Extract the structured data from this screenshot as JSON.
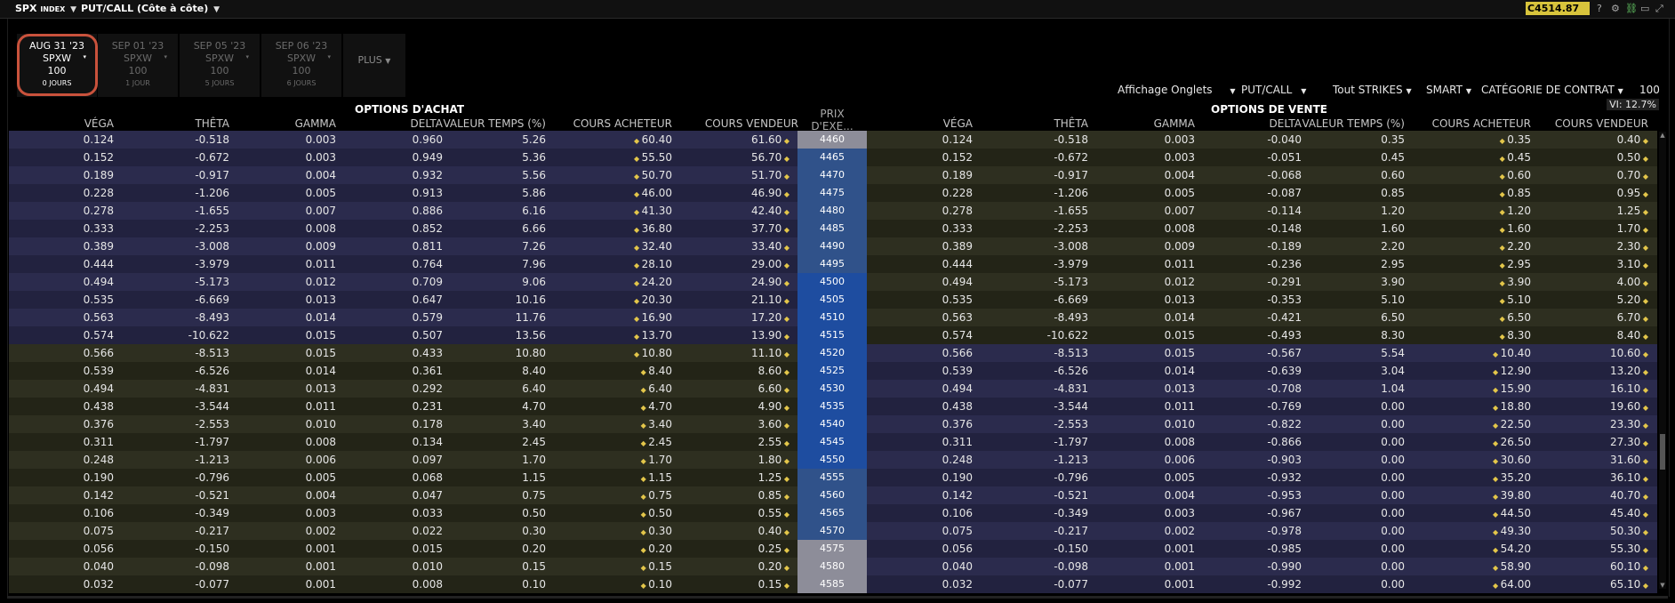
{
  "header": {
    "symbol": "SPX",
    "symbol_suffix": "INDEX",
    "view": "PUT/CALL (Côte à côte)",
    "price": "C4514.87"
  },
  "expirations": [
    {
      "date": "AUG 31 '23",
      "class": "SPXW",
      "mult": "100",
      "days": "0 JOURS"
    },
    {
      "date": "SEP 01 '23",
      "class": "SPXW",
      "mult": "100",
      "days": "1 JOUR"
    },
    {
      "date": "SEP 05 '23",
      "class": "SPXW",
      "mult": "100",
      "days": "5 JOURS"
    },
    {
      "date": "SEP 06 '23",
      "class": "SPXW",
      "mult": "100",
      "days": "6 JOURS"
    }
  ],
  "plus_label": "PLUS",
  "toolbar": {
    "affichage": "Affichage Onglets",
    "putcall": "PUT/CALL",
    "strikes": "Tout STRIKES",
    "smart": "SMART",
    "categorie": "CATÉGORIE DE CONTRAT",
    "qty": "100",
    "vi": "VI: 12.7%"
  },
  "sections": {
    "calls": "OPTIONS D'ACHAT",
    "puts": "OPTIONS DE VENTE"
  },
  "columns": {
    "vega": "VÉGA",
    "theta": "THÊTA",
    "gamma": "GAMMA",
    "delta": "DELTA",
    "time_value": "VALEUR TEMPS (%)",
    "bid": "COURS ACHETEUR",
    "ask": "COURS VENDEUR",
    "strike": "PRIX D'EXE..."
  },
  "rows": [
    {
      "strike": "4460",
      "call": [
        "0.124",
        "-0.518",
        "0.003",
        "0.960",
        "5.26",
        "60.40",
        "61.60"
      ],
      "put": [
        "0.124",
        "-0.518",
        "0.003",
        "-0.040",
        "0.35",
        "0.35",
        "0.40"
      ]
    },
    {
      "strike": "4465",
      "call": [
        "0.152",
        "-0.672",
        "0.003",
        "0.949",
        "5.36",
        "55.50",
        "56.70"
      ],
      "put": [
        "0.152",
        "-0.672",
        "0.003",
        "-0.051",
        "0.45",
        "0.45",
        "0.50"
      ]
    },
    {
      "strike": "4470",
      "call": [
        "0.189",
        "-0.917",
        "0.004",
        "0.932",
        "5.56",
        "50.70",
        "51.70"
      ],
      "put": [
        "0.189",
        "-0.917",
        "0.004",
        "-0.068",
        "0.60",
        "0.60",
        "0.70"
      ]
    },
    {
      "strike": "4475",
      "call": [
        "0.228",
        "-1.206",
        "0.005",
        "0.913",
        "5.86",
        "46.00",
        "46.90"
      ],
      "put": [
        "0.228",
        "-1.206",
        "0.005",
        "-0.087",
        "0.85",
        "0.85",
        "0.95"
      ]
    },
    {
      "strike": "4480",
      "call": [
        "0.278",
        "-1.655",
        "0.007",
        "0.886",
        "6.16",
        "41.30",
        "42.40"
      ],
      "put": [
        "0.278",
        "-1.655",
        "0.007",
        "-0.114",
        "1.20",
        "1.20",
        "1.25"
      ]
    },
    {
      "strike": "4485",
      "call": [
        "0.333",
        "-2.253",
        "0.008",
        "0.852",
        "6.66",
        "36.80",
        "37.70"
      ],
      "put": [
        "0.333",
        "-2.253",
        "0.008",
        "-0.148",
        "1.60",
        "1.60",
        "1.70"
      ]
    },
    {
      "strike": "4490",
      "call": [
        "0.389",
        "-3.008",
        "0.009",
        "0.811",
        "7.26",
        "32.40",
        "33.40"
      ],
      "put": [
        "0.389",
        "-3.008",
        "0.009",
        "-0.189",
        "2.20",
        "2.20",
        "2.30"
      ]
    },
    {
      "strike": "4495",
      "call": [
        "0.444",
        "-3.979",
        "0.011",
        "0.764",
        "7.96",
        "28.10",
        "29.00"
      ],
      "put": [
        "0.444",
        "-3.979",
        "0.011",
        "-0.236",
        "2.95",
        "2.95",
        "3.10"
      ]
    },
    {
      "strike": "4500",
      "call": [
        "0.494",
        "-5.173",
        "0.012",
        "0.709",
        "9.06",
        "24.20",
        "24.90"
      ],
      "put": [
        "0.494",
        "-5.173",
        "0.012",
        "-0.291",
        "3.90",
        "3.90",
        "4.00"
      ]
    },
    {
      "strike": "4505",
      "call": [
        "0.535",
        "-6.669",
        "0.013",
        "0.647",
        "10.16",
        "20.30",
        "21.10"
      ],
      "put": [
        "0.535",
        "-6.669",
        "0.013",
        "-0.353",
        "5.10",
        "5.10",
        "5.20"
      ]
    },
    {
      "strike": "4510",
      "call": [
        "0.563",
        "-8.493",
        "0.014",
        "0.579",
        "11.76",
        "16.90",
        "17.20"
      ],
      "put": [
        "0.563",
        "-8.493",
        "0.014",
        "-0.421",
        "6.50",
        "6.50",
        "6.70"
      ]
    },
    {
      "strike": "4515",
      "call": [
        "0.574",
        "-10.622",
        "0.015",
        "0.507",
        "13.56",
        "13.70",
        "13.90"
      ],
      "put": [
        "0.574",
        "-10.622",
        "0.015",
        "-0.493",
        "8.30",
        "8.30",
        "8.40"
      ]
    },
    {
      "strike": "4520",
      "call": [
        "0.566",
        "-8.513",
        "0.015",
        "0.433",
        "10.80",
        "10.80",
        "11.10"
      ],
      "put": [
        "0.566",
        "-8.513",
        "0.015",
        "-0.567",
        "5.54",
        "10.40",
        "10.60"
      ]
    },
    {
      "strike": "4525",
      "call": [
        "0.539",
        "-6.526",
        "0.014",
        "0.361",
        "8.40",
        "8.40",
        "8.60"
      ],
      "put": [
        "0.539",
        "-6.526",
        "0.014",
        "-0.639",
        "3.04",
        "12.90",
        "13.20"
      ]
    },
    {
      "strike": "4530",
      "call": [
        "0.494",
        "-4.831",
        "0.013",
        "0.292",
        "6.40",
        "6.40",
        "6.60"
      ],
      "put": [
        "0.494",
        "-4.831",
        "0.013",
        "-0.708",
        "1.04",
        "15.90",
        "16.10"
      ]
    },
    {
      "strike": "4535",
      "call": [
        "0.438",
        "-3.544",
        "0.011",
        "0.231",
        "4.70",
        "4.70",
        "4.90"
      ],
      "put": [
        "0.438",
        "-3.544",
        "0.011",
        "-0.769",
        "0.00",
        "18.80",
        "19.60"
      ]
    },
    {
      "strike": "4540",
      "call": [
        "0.376",
        "-2.553",
        "0.010",
        "0.178",
        "3.40",
        "3.40",
        "3.60"
      ],
      "put": [
        "0.376",
        "-2.553",
        "0.010",
        "-0.822",
        "0.00",
        "22.50",
        "23.30"
      ]
    },
    {
      "strike": "4545",
      "call": [
        "0.311",
        "-1.797",
        "0.008",
        "0.134",
        "2.45",
        "2.45",
        "2.55"
      ],
      "put": [
        "0.311",
        "-1.797",
        "0.008",
        "-0.866",
        "0.00",
        "26.50",
        "27.30"
      ]
    },
    {
      "strike": "4550",
      "call": [
        "0.248",
        "-1.213",
        "0.006",
        "0.097",
        "1.70",
        "1.70",
        "1.80"
      ],
      "put": [
        "0.248",
        "-1.213",
        "0.006",
        "-0.903",
        "0.00",
        "30.60",
        "31.60"
      ]
    },
    {
      "strike": "4555",
      "call": [
        "0.190",
        "-0.796",
        "0.005",
        "0.068",
        "1.15",
        "1.15",
        "1.25"
      ],
      "put": [
        "0.190",
        "-0.796",
        "0.005",
        "-0.932",
        "0.00",
        "35.20",
        "36.10"
      ]
    },
    {
      "strike": "4560",
      "call": [
        "0.142",
        "-0.521",
        "0.004",
        "0.047",
        "0.75",
        "0.75",
        "0.85"
      ],
      "put": [
        "0.142",
        "-0.521",
        "0.004",
        "-0.953",
        "0.00",
        "39.80",
        "40.70"
      ]
    },
    {
      "strike": "4565",
      "call": [
        "0.106",
        "-0.349",
        "0.003",
        "0.033",
        "0.50",
        "0.50",
        "0.55"
      ],
      "put": [
        "0.106",
        "-0.349",
        "0.003",
        "-0.967",
        "0.00",
        "44.50",
        "45.40"
      ]
    },
    {
      "strike": "4570",
      "call": [
        "0.075",
        "-0.217",
        "0.002",
        "0.022",
        "0.30",
        "0.30",
        "0.40"
      ],
      "put": [
        "0.075",
        "-0.217",
        "0.002",
        "-0.978",
        "0.00",
        "49.30",
        "50.30"
      ]
    },
    {
      "strike": "4575",
      "call": [
        "0.056",
        "-0.150",
        "0.001",
        "0.015",
        "0.20",
        "0.20",
        "0.25"
      ],
      "put": [
        "0.056",
        "-0.150",
        "0.001",
        "-0.985",
        "0.00",
        "54.20",
        "55.30"
      ]
    },
    {
      "strike": "4580",
      "call": [
        "0.040",
        "-0.098",
        "0.001",
        "0.010",
        "0.15",
        "0.15",
        "0.20"
      ],
      "put": [
        "0.040",
        "-0.098",
        "0.001",
        "-0.990",
        "0.00",
        "58.90",
        "60.10"
      ]
    },
    {
      "strike": "4585",
      "call": [
        "0.032",
        "-0.077",
        "0.001",
        "0.008",
        "0.10",
        "0.10",
        "0.15"
      ],
      "put": [
        "0.032",
        "-0.077",
        "0.001",
        "-0.992",
        "0.00",
        "64.00",
        "65.10"
      ]
    }
  ],
  "colors": {
    "call_itm": "#2b2b4d",
    "call_itm_alt": "#22223f",
    "call_otm": "#2e2f20",
    "call_otm_alt": "#232417",
    "strike_itm": "#30528a",
    "strike_atm": "#1e4da0",
    "strike_far": "#8d8d99",
    "accent": "#d8c43c",
    "active_ring": "#c9523c"
  }
}
